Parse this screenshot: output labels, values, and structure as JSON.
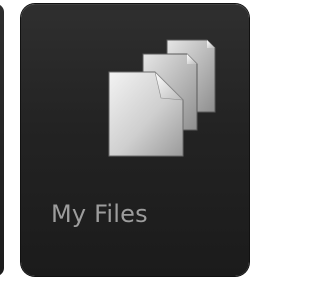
{
  "tile": {
    "label": "My Files",
    "icon": "documents-stack-icon"
  },
  "colors": {
    "tile_background": "#1f1f1f",
    "label": "#9d9d9d"
  }
}
